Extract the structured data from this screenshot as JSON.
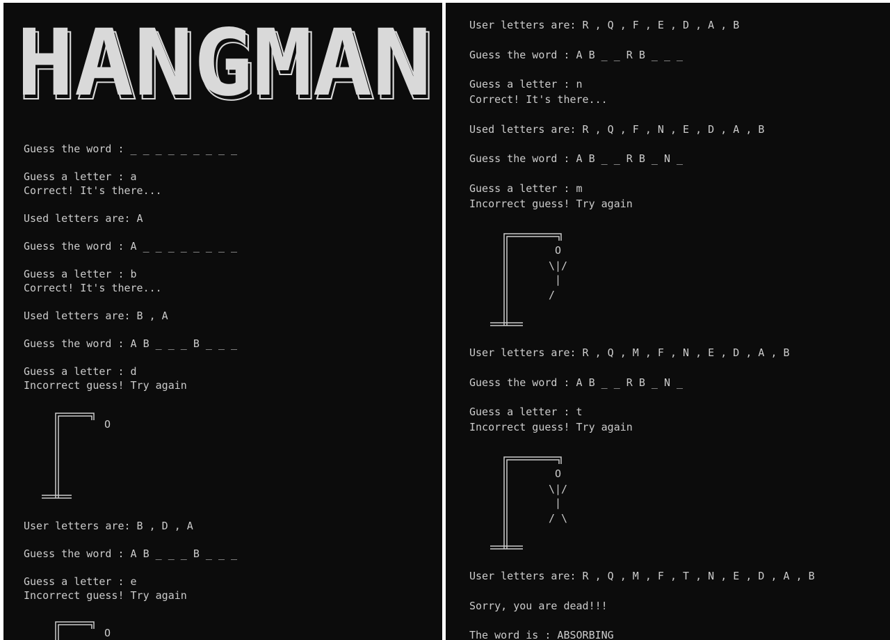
{
  "colors": {
    "background": "#0c0c0c",
    "text": "#cccccc",
    "banner": "#d9d9d9"
  },
  "left_pane": {
    "banner_title": "HANGMAN",
    "lines": [
      "Guess the word : _ _ _ _ _ _ _ _ _",
      "Guess a letter : a",
      "Correct! It's there...",
      "Used letters are: A",
      "Guess the word : A _ _ _ _ _ _ _ _",
      "Guess a letter : b",
      "Correct! It's there...",
      "Used letters are: B , A",
      "Guess the word : A B _ _ _ B _ _ _",
      "Guess a letter : d",
      "Incorrect guess! Try again",
      "User letters are: B , D , A",
      "Guess the word : A B _ _ _ B _ _ _",
      "Guess a letter : e",
      "Incorrect guess! Try again"
    ],
    "gallows": [
      {
        "head": "O",
        "arms": "",
        "torso": "",
        "legs": ""
      },
      {
        "head": "O",
        "arms": "",
        "torso": "",
        "legs": ""
      }
    ]
  },
  "right_pane": {
    "lines": [
      "User letters are: R , Q , F , E , D , A , B",
      "Guess the word : A B _ _ R B _ _ _",
      "Guess a letter : n",
      "Correct! It's there...",
      "Used letters are: R , Q , F , N , E , D , A , B",
      "Guess the word : A B _ _ R B _ N _",
      "Guess a letter : m",
      "Incorrect guess! Try again",
      "User letters are: R , Q , M , F , N , E , D , A , B",
      "Guess the word : A B _ _ R B _ N _",
      "Guess a letter : t",
      "Incorrect guess! Try again",
      "User letters are: R , Q , M , F , T , N , E , D , A , B",
      "Sorry, you are dead!!!",
      "The word is : ABSORBING"
    ],
    "gallows": [
      {
        "head": "O",
        "arms": "\\|/",
        "torso": "|",
        "legs": "/"
      },
      {
        "head": "O",
        "arms": "\\|/",
        "torso": "|",
        "legs": "/ \\"
      }
    ]
  }
}
